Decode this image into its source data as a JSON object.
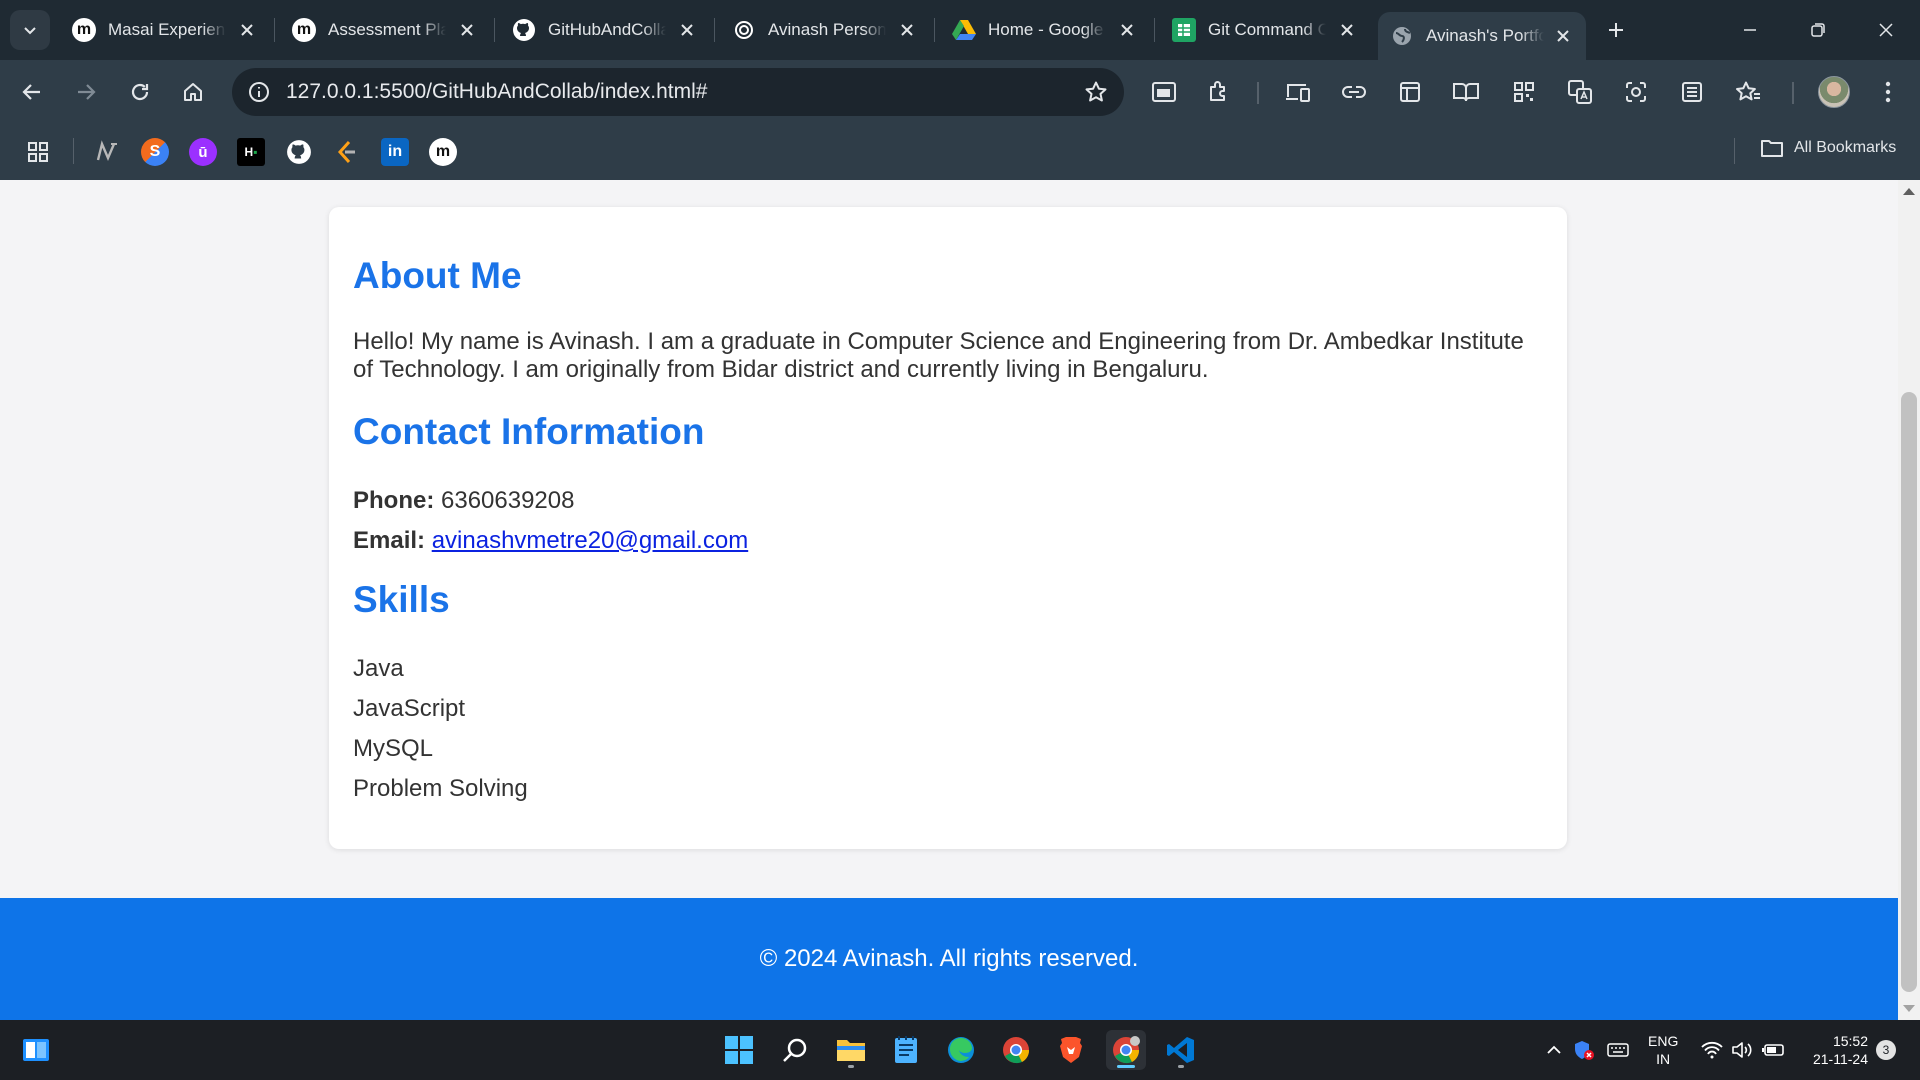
{
  "browser": {
    "tabs": [
      {
        "title": "Masai Experience",
        "favicon": "masai-icon"
      },
      {
        "title": "Assessment Platform",
        "favicon": "masai-icon"
      },
      {
        "title": "GitHubAndCollab",
        "favicon": "github-icon"
      },
      {
        "title": "Avinash Personal",
        "favicon": "openai-icon"
      },
      {
        "title": "Home - Google Drive",
        "favicon": "google-drive-icon"
      },
      {
        "title": "Git Command Cheat",
        "favicon": "google-sheets-icon"
      },
      {
        "title": "Avinash's Portfolio",
        "favicon": "globe-icon",
        "active": true
      }
    ],
    "url": "127.0.0.1:5500/GitHubAndCollab/index.html#",
    "bookmarks_label": "All Bookmarks"
  },
  "page": {
    "about_heading": "About Me",
    "about_text": "Hello! My name is Avinash. I am a graduate in Computer Science and Engineering from Dr. Ambedkar Institute of Technology. I am originally from Bidar district and currently living in Bengaluru.",
    "contact_heading": "Contact Information",
    "phone_label": "Phone:",
    "phone_value": "6360639208",
    "email_label": "Email:",
    "email_value": "avinashvmetre20@gmail.com",
    "skills_heading": "Skills",
    "skills": [
      "Java",
      "JavaScript",
      "MySQL",
      "Problem Solving"
    ],
    "footer_text": "© 2024 Avinash. All rights reserved."
  },
  "taskbar": {
    "lang_line1": "ENG",
    "lang_line2": "IN",
    "time": "15:52",
    "date": "21-11-24",
    "notification_count": "3"
  },
  "colors": {
    "accent": "#1a73e8",
    "footer": "#0e74e8",
    "link": "#0b22e0"
  }
}
